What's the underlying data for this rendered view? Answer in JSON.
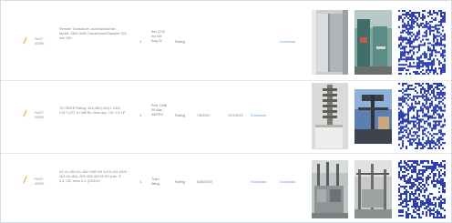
{
  "rows": [
    {
      "code": "FACF 00095",
      "description": "Remote Transducer, autotransformer, Model: SBH-0085 Transformer/Sampler 000 mm 000",
      "quantity": "1",
      "unit": "Set 1212 mo ola Aug 21",
      "status": "Rating",
      "date_installed": "",
      "date_updated": "",
      "link_view": "",
      "link_download": "Download",
      "photo1_icon": "metal-panel-photo",
      "photo2_icon": "substation-equipment-photo",
      "qr_icon": "qr-code"
    },
    {
      "code": "FACF 00094",
      "description": "TU SEIKE Rating: 444,463 (163) L 2321 L25 3 (27) 10 365 Bo 4mm opc. U3. 0.5 1P",
      "quantity": "1",
      "unit": "Pole 1288 30 Alta 00/PES",
      "status": "Rating",
      "date_installed": "7/6/2017",
      "date_updated": "7/17/2022",
      "link_view": "Showcase",
      "link_download": "",
      "photo1_icon": "porcelain-insulator-photo",
      "photo2_icon": "transmission-tower-photo",
      "qr_icon": "qr-code"
    },
    {
      "code": "FACF 00093",
      "description": "AC 01-453 AC-484 1000 AH 4015 L03-1609 403 0A 1BA- 009 4DD 66705 R4 prdo. E 3.3, CB, dmm 0.1 (CD424)",
      "quantity": "1",
      "unit": "Tram fitting",
      "status": "Rating",
      "date_installed": "6/25/2019",
      "date_updated": "",
      "link_view": "Showcase",
      "link_download": "Download",
      "photo1_icon": "switchgear-photo",
      "photo2_icon": "substation-structure-photo",
      "qr_icon": "qr-code"
    }
  ],
  "colors": {
    "edit_icon": "#e8b12a",
    "link": "#6aa0e0",
    "qr": "#2b3fb3"
  }
}
